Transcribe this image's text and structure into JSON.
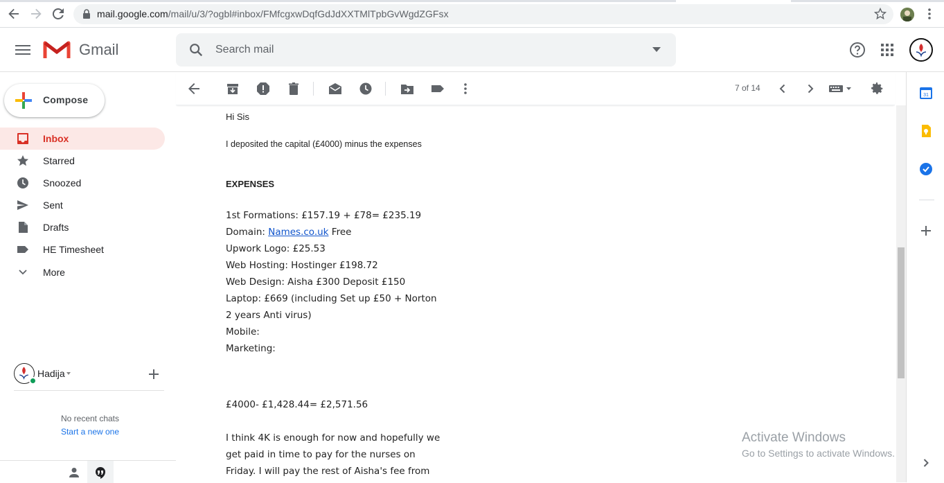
{
  "browser": {
    "url_host": "mail.google.com",
    "url_path": "/mail/u/3/?ogbl#inbox/FMfcgxwDqfGdJdXXTMlTpbGvWgdZGFsx"
  },
  "header": {
    "app_name": "Gmail",
    "search_placeholder": "Search mail"
  },
  "sidebar": {
    "compose_label": "Compose",
    "items": [
      {
        "label": "Inbox",
        "icon": "inbox-icon",
        "active": true
      },
      {
        "label": "Starred",
        "icon": "star-icon"
      },
      {
        "label": "Snoozed",
        "icon": "clock-icon"
      },
      {
        "label": "Sent",
        "icon": "send-icon"
      },
      {
        "label": "Drafts",
        "icon": "draft-icon"
      },
      {
        "label": "HE Timesheet",
        "icon": "label-icon"
      },
      {
        "label": "More",
        "icon": "chevron-down-icon"
      }
    ]
  },
  "hangouts": {
    "user_name": "Hadija",
    "no_recent": "No recent chats",
    "start_new": "Start a new one"
  },
  "toolbar": {
    "pager": "7 of 14"
  },
  "email": {
    "greeting": "Hi Sis",
    "deposit_line": "I deposited the capital (£4000) minus the expenses",
    "expenses_heading": "EXPENSES",
    "line_formations": "1st Formations: £157.19 + £78= £235.19",
    "domain_prefix": "Domain: ",
    "domain_link": "Names.co.uk",
    "domain_suffix": " Free",
    "line_logo": "Upwork Logo: £25.53",
    "line_hosting": "Web Hosting: Hostinger £198.72",
    "line_design": "Web Design: Aisha £300 Deposit £150",
    "line_laptop": "Laptop: £669 (including Set up £50 + Norton 2 years Anti virus)",
    "line_mobile": "Mobile:",
    "line_marketing": "Marketing:",
    "calculation": "£4000- £1,428.44= £2,571.56",
    "closing_paragraph": "I think 4K is enough for now and hopefully we get paid in time to pay for the nurses on Friday. I will pay the rest of Aisha's fee from"
  },
  "watermark": {
    "title": "Activate Windows",
    "subtitle": "Go to Settings to activate Windows."
  },
  "side_panel": {
    "calendar_day": "31"
  },
  "colors": {
    "active_bg": "#fce8e6",
    "active_text": "#d93025",
    "link": "#1155cc",
    "search_bg": "#f1f3f4"
  }
}
